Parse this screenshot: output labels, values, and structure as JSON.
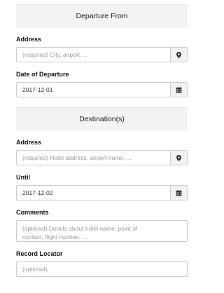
{
  "departure": {
    "title": "Departure From",
    "address_label": "Address",
    "address_placeholder": "(required) City, airport, ...",
    "address_icon": "map-marker-icon",
    "date_label": "Date of Departure",
    "date_value": "2017-12-01",
    "date_icon": "calendar-icon"
  },
  "destination": {
    "title": "Destination(s)",
    "address_label": "Address",
    "address_placeholder": "(required) Hotel address, airport name, ...",
    "address_icon": "map-marker-icon",
    "until_label": "Until",
    "until_value": "2017-12-02",
    "until_icon": "calendar-icon",
    "comments_label": "Comments",
    "comments_placeholder_line1": "(optional) Details about hotel name, point of",
    "comments_placeholder_line2": "contact, flight number, ...",
    "record_locator_label": "Record Locator",
    "record_locator_placeholder": "(optional)"
  },
  "colors": {
    "header_bg": "#f3f3f3",
    "border": "#cccccc",
    "addon_bg": "#f2f2f2",
    "placeholder": "#9a9a9a",
    "text": "#333333"
  }
}
